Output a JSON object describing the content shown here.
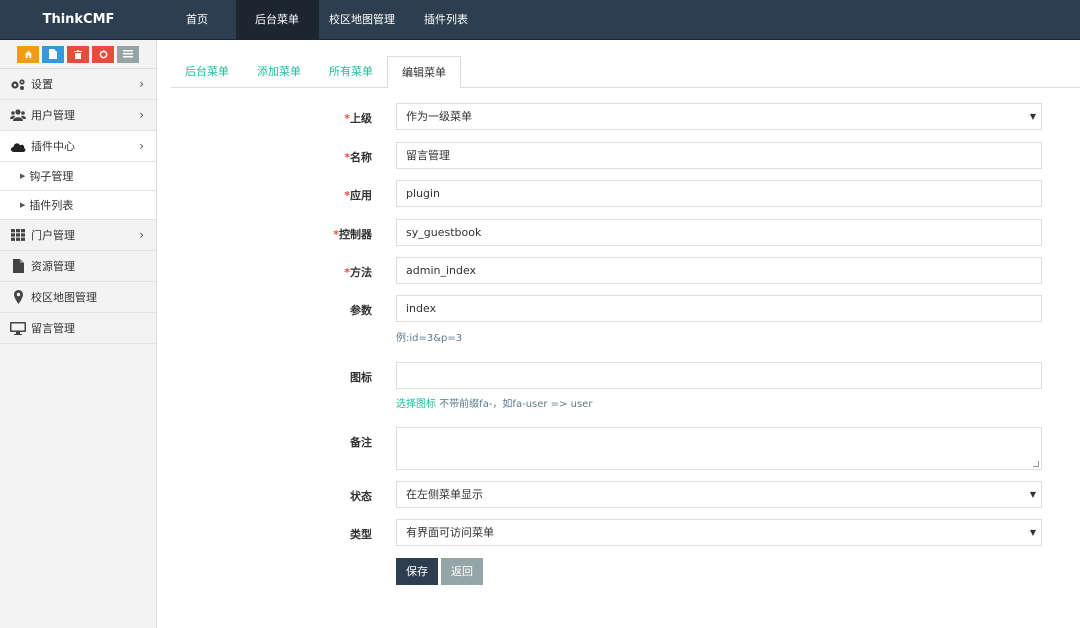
{
  "app": {
    "brand": "ThinkCMF"
  },
  "topnav": [
    {
      "label": "首页"
    },
    {
      "label": "后台菜单"
    },
    {
      "label": "校区地图管理"
    },
    {
      "label": "插件列表"
    }
  ],
  "shortcuts": [
    {
      "icon": "home-icon",
      "glyph": "⌂",
      "color": "#f39c12"
    },
    {
      "icon": "file-icon",
      "glyph": "▯",
      "color": "#3498db"
    },
    {
      "icon": "trash-icon",
      "glyph": "🗑",
      "color": "#e74c3c"
    },
    {
      "icon": "recycle-icon",
      "glyph": "♻",
      "color": "#e74c3c"
    },
    {
      "icon": "list-icon",
      "glyph": "☰",
      "color": "#95a5a6"
    }
  ],
  "sidebar": {
    "items": [
      {
        "label": "设置",
        "icon": "gears-icon",
        "has_children": true
      },
      {
        "label": "用户管理",
        "icon": "users-icon",
        "has_children": true
      },
      {
        "label": "插件中心",
        "icon": "cloud-icon",
        "has_children": true,
        "expanded": true,
        "children": [
          {
            "label": "钩子管理"
          },
          {
            "label": "插件列表"
          }
        ]
      },
      {
        "label": "门户管理",
        "icon": "grid-icon",
        "has_children": true
      },
      {
        "label": "资源管理",
        "icon": "file-icon",
        "has_children": false
      },
      {
        "label": "校区地图管理",
        "icon": "map-marker-icon",
        "has_children": false
      },
      {
        "label": "留言管理",
        "icon": "desktop-icon",
        "has_children": false
      }
    ]
  },
  "tabs": [
    {
      "label": "后台菜单"
    },
    {
      "label": "添加菜单"
    },
    {
      "label": "所有菜单"
    },
    {
      "label": "编辑菜单",
      "active": true
    }
  ],
  "form": {
    "parent": {
      "label": "上级",
      "required": "*",
      "value": "作为一级菜单"
    },
    "name": {
      "label": "名称",
      "required": "*",
      "value": "留言管理"
    },
    "app": {
      "label": "应用",
      "required": "*",
      "value": "plugin"
    },
    "controller": {
      "label": "控制器",
      "required": "*",
      "value": "sy_guestbook"
    },
    "action": {
      "label": "方法",
      "required": "*",
      "value": "admin_index"
    },
    "params": {
      "label": "参数",
      "value": "index",
      "help": "例:id=3&p=3"
    },
    "icon": {
      "label": "图标",
      "value": "",
      "help_link": "选择图标",
      "help_text": " 不带前缀fa-，如fa-user => user"
    },
    "remark": {
      "label": "备注",
      "value": ""
    },
    "status": {
      "label": "状态",
      "value": "在左侧菜单显示"
    },
    "type": {
      "label": "类型",
      "value": "有界面可访问菜单"
    },
    "save_label": "保存",
    "back_label": "返回"
  }
}
